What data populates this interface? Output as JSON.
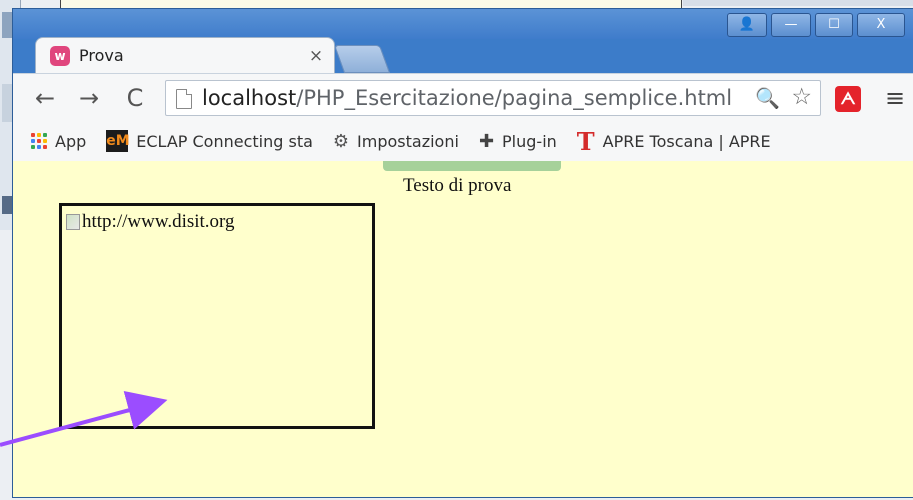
{
  "window": {
    "controls": {
      "user_glyph": "👤",
      "minimize_glyph": "—",
      "maximize_glyph": "☐",
      "close_glyph": "X"
    }
  },
  "tab": {
    "title": "Prova",
    "favicon_letter": "w",
    "close_glyph": "×"
  },
  "toolbar": {
    "back_glyph": "←",
    "forward_glyph": "→",
    "reload_glyph": "C",
    "url_host": "localhost",
    "url_path": "/PHP_Esercitazione/pagina_semplice.html",
    "zoom_glyph": "🔍",
    "star_glyph": "☆",
    "extension_glyph": "ᗅ",
    "menu_glyph": "≡"
  },
  "bookmarks": [
    {
      "label": "App",
      "icon": "apps-grid-icon"
    },
    {
      "label": "ECLAP Connecting sta",
      "icon": "eclap-icon",
      "icon_text": "eM"
    },
    {
      "label": "Impostazioni",
      "icon": "gear-icon"
    },
    {
      "label": "Plug-in",
      "icon": "puzzle-icon"
    },
    {
      "label": "APRE Toscana | APRE",
      "icon": "t-icon",
      "icon_text": "T"
    }
  ],
  "page": {
    "heading": "Testo di prova",
    "image_alt": "http://www.disit.org"
  },
  "colors": {
    "page_background": "#ffffcc",
    "frame_blue": "#3c7cc9",
    "annotation_arrow": "#9b4dff"
  }
}
